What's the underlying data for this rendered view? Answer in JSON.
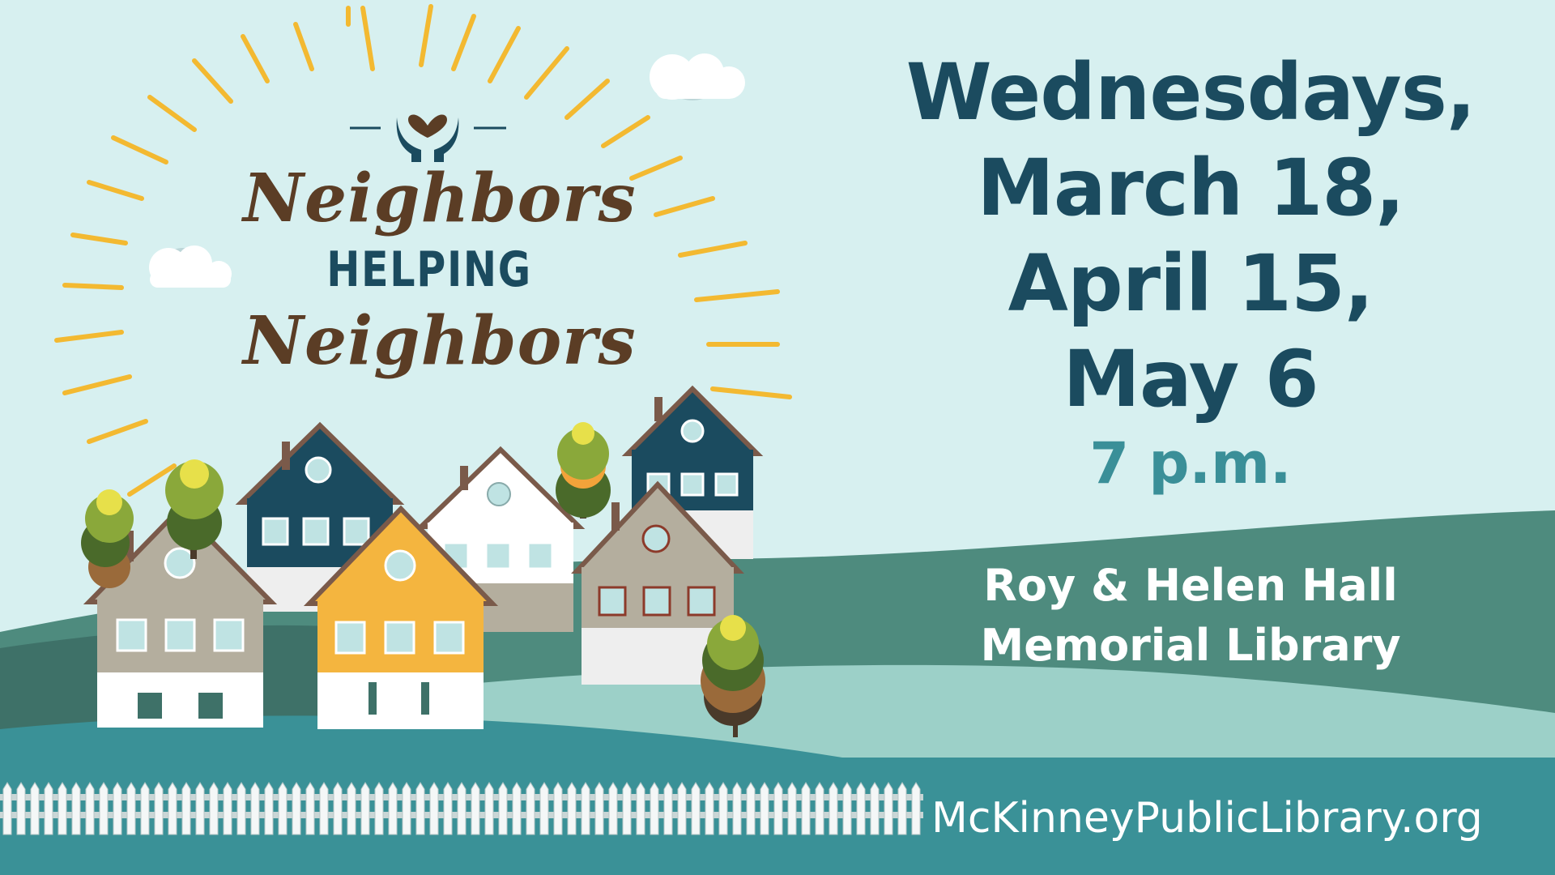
{
  "title": {
    "line1": "Neighbors",
    "line2": "HELPING",
    "line3": "Neighbors"
  },
  "logo_icon": "heart-in-hands-icon",
  "dates": [
    "Wednesdays,",
    "March 18,",
    "April 15,",
    "May 6"
  ],
  "time": "7 p.m.",
  "venue": {
    "line1": "Roy & Helen Hall",
    "line2": "Memorial Library"
  },
  "website": "McKinneyPublicLibrary.org",
  "colors": {
    "sky": "#d7f0f0",
    "dark_teal": "#1b4b5f",
    "mid_teal": "#3a8f98",
    "hill_green": "#4e8b7e",
    "ground_teal": "#3a9197",
    "sun_rays": "#f3b931",
    "title_brown": "#5b3d25"
  }
}
